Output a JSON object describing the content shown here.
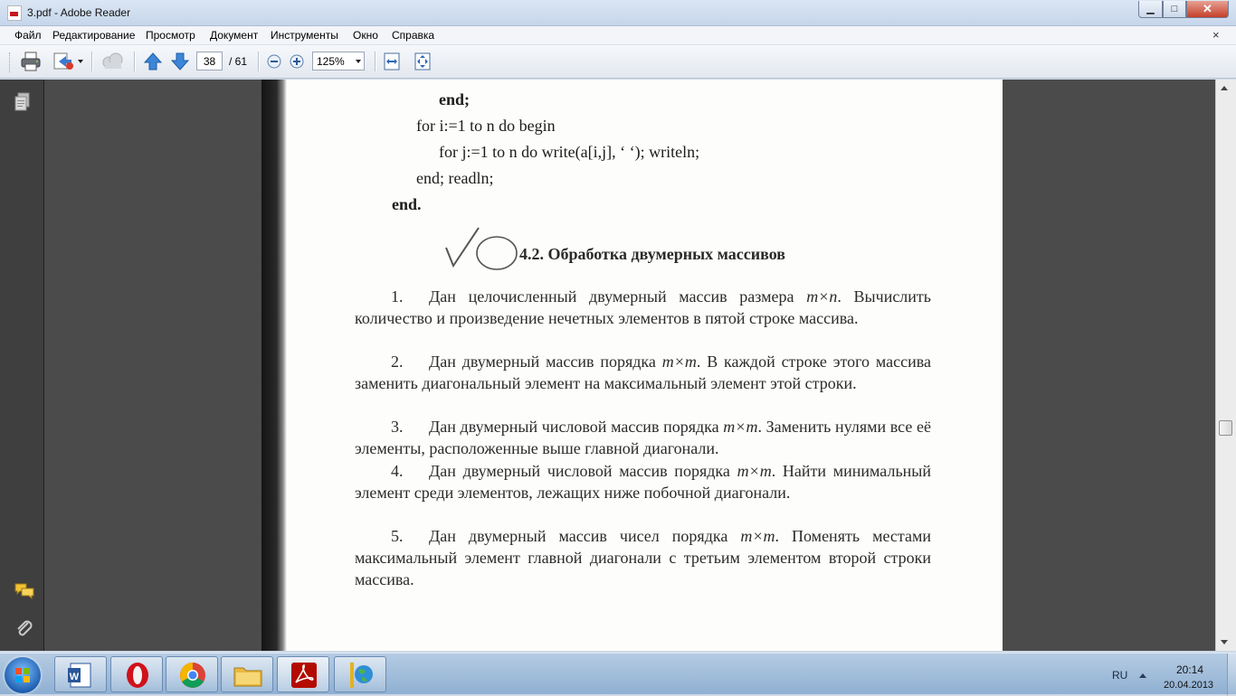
{
  "window": {
    "title": "3.pdf - Adobe Reader",
    "minimize": "▁",
    "maximize": "□",
    "close": "✕"
  },
  "menu": {
    "items": [
      "Файл",
      "Редактирование",
      "Просмотр",
      "Документ",
      "Инструменты",
      "Окно",
      "Справка"
    ],
    "close": "×"
  },
  "toolbar": {
    "icons": [
      "printer-icon",
      "share-icon",
      "cloud-icon",
      "up-arrow-icon",
      "down-arrow-icon",
      "zoom-out-icon",
      "zoom-in-icon",
      "fit-width-icon",
      "fit-page-icon"
    ],
    "page_current": "38",
    "page_total": "/ 61",
    "zoom": "125%"
  },
  "document": {
    "code_lines": [
      "end;",
      "for i:=1 to n do begin",
      "for j:=1 to n do write(a[i,j], ‘ ‘); writeln;",
      "end; readln;",
      "end."
    ],
    "section_number": "4.2.",
    "section_title": "Обработка двумерных массивов",
    "tasks": [
      {
        "num": "1.",
        "text": "Дан целочисленный двумерный массив размера",
        "math": "m×n",
        "rest": ". Вычислить количество и произведение нечетных элементов в пятой строке массива."
      },
      {
        "num": "2.",
        "text": "Дан двумерный массив порядка",
        "math": "m×m",
        "rest": ". В каждой строке этого массива заменить диагональный элемент на максимальный элемент этой строки."
      },
      {
        "num": "3.",
        "text": "Дан двумерный числовой массив порядка",
        "math": "m×m",
        "rest": ". Заменить нулями все её элементы, расположенные выше главной диагонали."
      },
      {
        "num": "4.",
        "text": "Дан двумерный числовой массив порядка",
        "math": "m×m",
        "rest": ". Найти минимальный элемент среди элементов, лежащих ниже побочной диагонали."
      },
      {
        "num": "5.",
        "text": "Дан двумерный массив чисел порядка",
        "math": "m×m",
        "rest": ". Поменять местами максимальный элемент главной диагонали с третьим элементом второй строки массива."
      }
    ]
  },
  "nav": {
    "icons": [
      "pages-icon",
      "comments-icon",
      "attachments-icon"
    ]
  },
  "taskbar": {
    "apps": [
      "word-icon",
      "opera-icon",
      "chrome-icon",
      "explorer-icon",
      "adobe-reader-icon",
      "globe-app-icon"
    ],
    "lang": "RU",
    "time": "20:14",
    "date": "20.04.2013"
  }
}
